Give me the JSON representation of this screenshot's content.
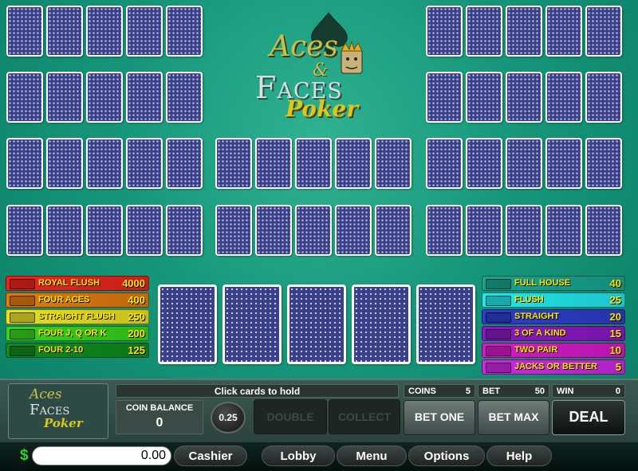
{
  "game_title": {
    "line1": "Aces",
    "amp": "&",
    "line2": "Faces",
    "line3": "Poker"
  },
  "paytable_left": [
    {
      "name": "ROYAL FLUSH",
      "value": "4000",
      "color": "#e8251e"
    },
    {
      "name": "FOUR ACES",
      "value": "400",
      "color": "#e07a10"
    },
    {
      "name": "STRAIGHT FLUSH",
      "value": "250",
      "color": "#e8e020"
    },
    {
      "name": "FOUR J, Q OR K",
      "value": "200",
      "color": "#36d31c"
    },
    {
      "name": "FOUR 2-10",
      "value": "125",
      "color": "#0f8a1e"
    }
  ],
  "paytable_right": [
    {
      "name": "FULL HOUSE",
      "value": "40",
      "color": "#16a58f"
    },
    {
      "name": "FLUSH",
      "value": "25",
      "color": "#22e6ea"
    },
    {
      "name": "STRAIGHT",
      "value": "20",
      "color": "#2d3ec7"
    },
    {
      "name": "3 OF A KIND",
      "value": "15",
      "color": "#8a18c2"
    },
    {
      "name": "TWO PAIR",
      "value": "10",
      "color": "#d41ac8"
    },
    {
      "name": "JACKS OR BETTER",
      "value": "5",
      "color": "#cc28e2"
    }
  ],
  "panel": {
    "status": "Click cards to hold",
    "coin_balance_label": "COIN BALANCE",
    "coin_balance_value": "0",
    "coin_value": "0.25",
    "coins_label": "COINS",
    "coins_value": "5",
    "bet_label": "BET",
    "bet_value": "50",
    "win_label": "WIN",
    "win_value": "0",
    "double_label": "DOUBLE",
    "collect_label": "COLLECT",
    "bet_one_label": "BET ONE",
    "bet_max_label": "BET MAX",
    "deal_label": "DEAL"
  },
  "bottom_bar": {
    "currency_symbol": "$",
    "balance": "0.00",
    "cashier": "Cashier",
    "lobby": "Lobby",
    "menu": "Menu",
    "options": "Options",
    "help": "Help"
  },
  "colors": {
    "felt": "#15967a",
    "card_back": "#3a3f8a",
    "paytable_text": "#ffe600"
  },
  "icons": [
    "spade-icon",
    "king-face-icon",
    "card-back-pattern"
  ]
}
